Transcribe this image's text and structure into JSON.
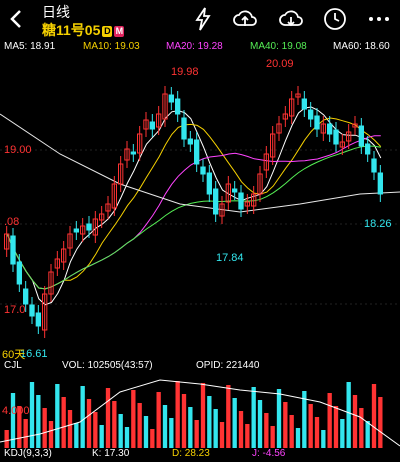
{
  "header": {
    "title": "日线",
    "subtitle": "糖11号05",
    "badge_d": "D",
    "badge_m": "M"
  },
  "ma_legend": [
    {
      "label": "MA5: 18.91",
      "color": "#ffffff"
    },
    {
      "label": "MA10: 19.03",
      "color": "#f5d000"
    },
    {
      "label": "MA20: 19.28",
      "color": "#ff44ff"
    },
    {
      "label": "MA40: 19.08",
      "color": "#55ee55"
    },
    {
      "label": "MA60: 18.60",
      "color": "#ffffff"
    }
  ],
  "price_labels": {
    "high1": "19.98",
    "high2": "20.09",
    "low_mid": "17.84",
    "last": "18.26",
    "axis_19": "19.00",
    "axis_18": ".08",
    "axis_17": "17.0",
    "low_left": "16.61",
    "period": "60天"
  },
  "volume": {
    "cjl": "CJL",
    "vol": "VOL: 102505(43:57)",
    "opid": "OPID: 221440",
    "axis": "4.000"
  },
  "kdj": {
    "name": "KDJ(9,3,3)",
    "k": "K: 17.30",
    "d": "D: 28.23",
    "j": "J: -4.56"
  },
  "colors": {
    "up": "#ff3333",
    "down": "#33e6ee",
    "accent": "#f5d000"
  },
  "icons": [
    "back-icon",
    "flash-icon",
    "cloud-upload-icon",
    "cloud-download-icon",
    "clock-icon",
    "more-icon"
  ]
}
